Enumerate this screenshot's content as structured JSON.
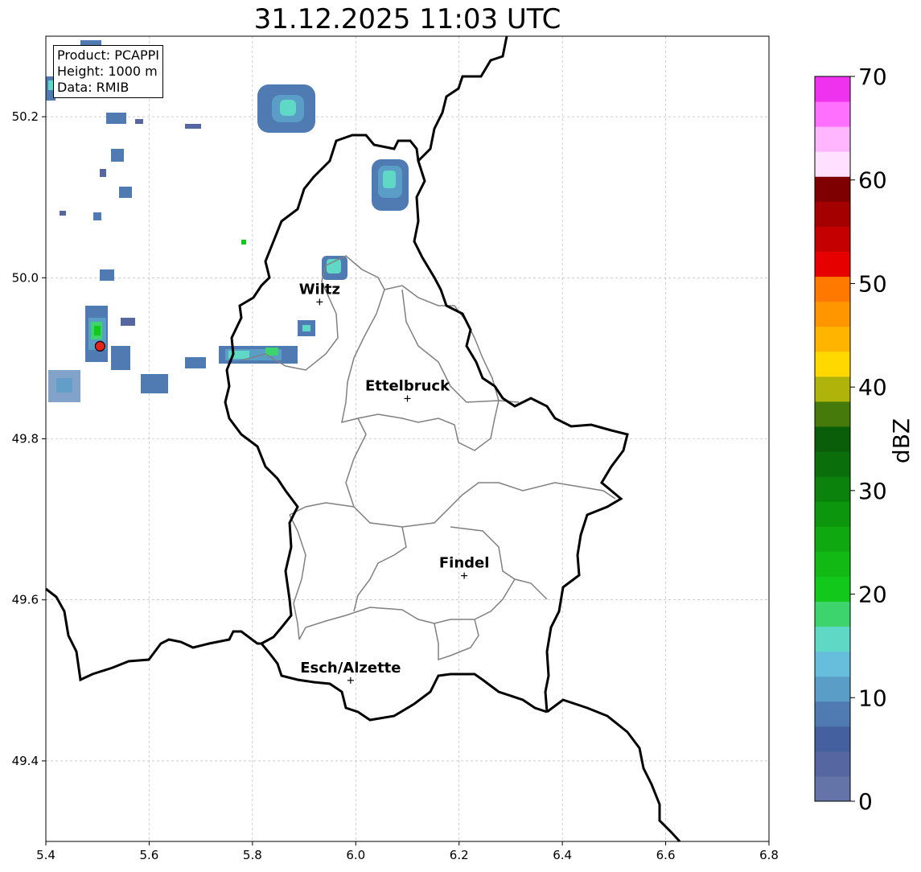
{
  "title": "31.12.2025 11:03 UTC",
  "info": {
    "product": "Product: PCAPPI",
    "height": "Height: 1000 m",
    "data": "Data: RMIB"
  },
  "x_ticks": [
    "5.4",
    "5.6",
    "5.8",
    "6.0",
    "6.2",
    "6.4",
    "6.6",
    "6.8"
  ],
  "y_ticks": [
    "50.2",
    "50.0",
    "49.8",
    "49.6",
    "49.4"
  ],
  "cities": [
    {
      "name": "Wiltz",
      "lon": 5.93,
      "lat": 49.97
    },
    {
      "name": "Ettelbruck",
      "lon": 6.1,
      "lat": 49.85
    },
    {
      "name": "Findel",
      "lon": 6.21,
      "lat": 49.63
    },
    {
      "name": "Esch/Alzette",
      "lon": 5.99,
      "lat": 49.5
    }
  ],
  "radar_site": {
    "lon": 5.505,
    "lat": 49.915,
    "color": "#e8231c"
  },
  "colorbar": {
    "label": "dBZ",
    "ticks": [
      "0",
      "10",
      "20",
      "30",
      "40",
      "50",
      "60",
      "70"
    ],
    "colors": [
      "#6473a8",
      "#5666a0",
      "#44609e",
      "#4f7bb2",
      "#5a9ec8",
      "#66bedc",
      "#5fd8c6",
      "#3dd46e",
      "#12c81a",
      "#12b814",
      "#0fa810",
      "#0c960e",
      "#0a820c",
      "#0a6e0a",
      "#0a5e0a",
      "#467a0a",
      "#b0b40a",
      "#ffd800",
      "#ffb400",
      "#ff9600",
      "#ff7800",
      "#e60000",
      "#c40000",
      "#a40000",
      "#7e0000",
      "#ffe0ff",
      "#ffb6ff",
      "#ff70ff",
      "#ee32ee"
    ]
  },
  "extent": {
    "lon_min": 5.4,
    "lon_max": 6.8,
    "lat_min": 49.3,
    "lat_max": 50.3
  }
}
